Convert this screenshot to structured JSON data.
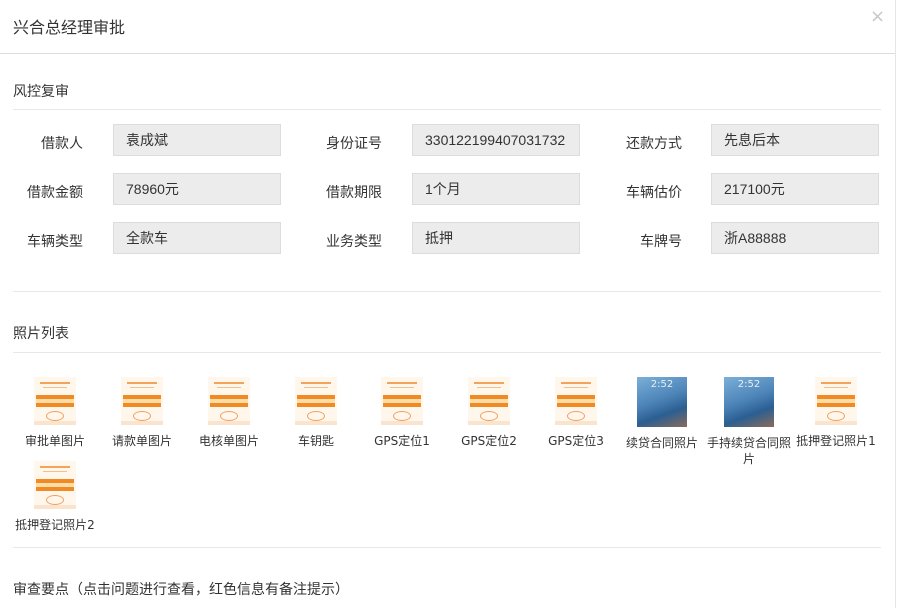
{
  "modal": {
    "title": "兴合总经理审批",
    "close_symbol": "×"
  },
  "sections": {
    "risk_review": "风控复审",
    "photo_list": "照片列表",
    "review_points": "审查要点（点击问题进行查看，红色信息有备注提示）"
  },
  "fields": {
    "borrower": {
      "label": "借款人",
      "value": "袁成斌"
    },
    "id_number": {
      "label": "身份证号",
      "value": "330122199407031732"
    },
    "repayment_method": {
      "label": "还款方式",
      "value": "先息后本"
    },
    "loan_amount": {
      "label": "借款金额",
      "value": "78960元"
    },
    "loan_term": {
      "label": "借款期限",
      "value": "1个月"
    },
    "vehicle_valuation": {
      "label": "车辆估价",
      "value": "217100元"
    },
    "vehicle_type": {
      "label": "车辆类型",
      "value": "全款车"
    },
    "business_type": {
      "label": "业务类型",
      "value": "抵押"
    },
    "plate_number": {
      "label": "车牌号",
      "value": "浙A88888"
    }
  },
  "photos": [
    {
      "label": "审批单图片",
      "thumb": "doc"
    },
    {
      "label": "请款单图片",
      "thumb": "doc"
    },
    {
      "label": "电核单图片",
      "thumb": "doc"
    },
    {
      "label": "车钥匙",
      "thumb": "doc"
    },
    {
      "label": "GPS定位1",
      "thumb": "doc"
    },
    {
      "label": "GPS定位2",
      "thumb": "doc"
    },
    {
      "label": "GPS定位3",
      "thumb": "doc"
    },
    {
      "label": "续贷合同照片",
      "thumb": "phone"
    },
    {
      "label": "手持续贷合同照片",
      "thumb": "phone"
    },
    {
      "label": "抵押登记照片1",
      "thumb": "doc"
    },
    {
      "label": "抵押登记照片2",
      "thumb": "doc"
    }
  ],
  "phone_clock_text": "2:52",
  "colors": {
    "accent_orange": "#f08a24",
    "field_bg": "#ececec"
  }
}
